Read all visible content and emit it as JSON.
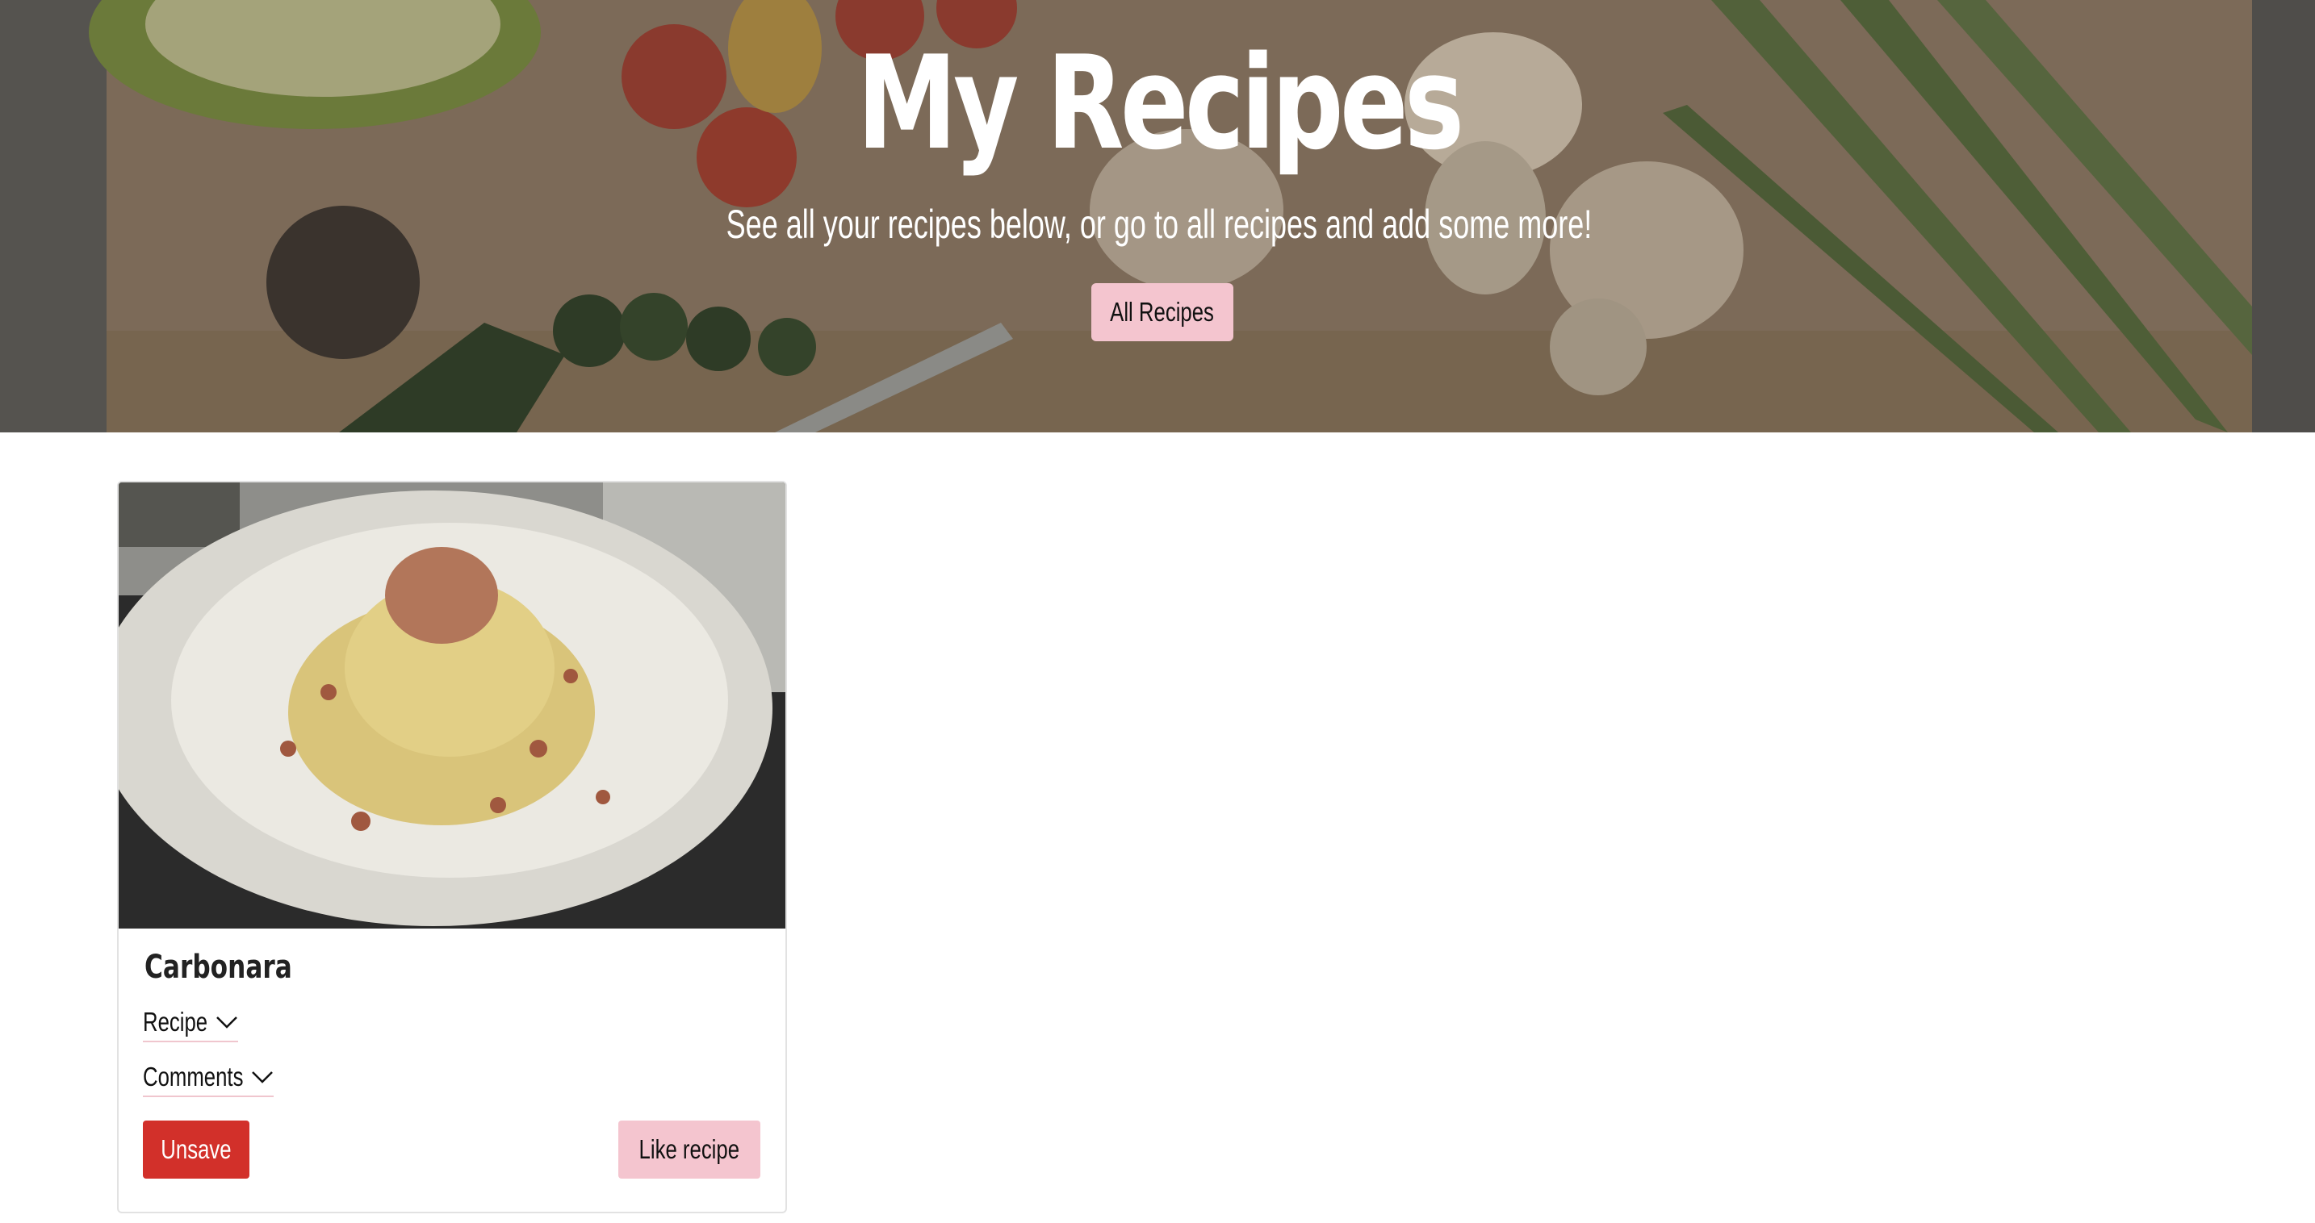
{
  "hero": {
    "title": "My Recipes",
    "subtitle": "See all your recipes below, or go to all recipes and add some more!",
    "button_label": "All Recipes"
  },
  "recipes": [
    {
      "title": "Carbonara",
      "recipe_toggle_label": "Recipe",
      "comments_toggle_label": "Comments",
      "unsave_label": "Unsave",
      "like_label": "Like recipe"
    }
  ],
  "icons": {
    "recipe_toggle": "chevron-down-icon",
    "comments_toggle": "chevron-down-icon"
  },
  "colors": {
    "accent_pink": "#f4c5cf",
    "unsave_red": "#d2302a",
    "hero_overlay": "#6e655c"
  }
}
